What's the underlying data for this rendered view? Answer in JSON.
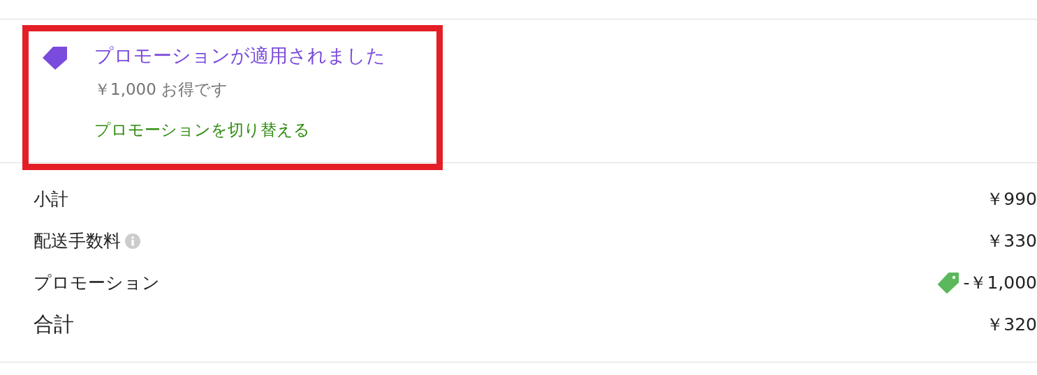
{
  "promotion": {
    "title": "プロモーションが適用されました",
    "savings": "￥1,000 お得です",
    "change_link": "プロモーションを切り替える",
    "highlighted": true
  },
  "summary": [
    {
      "kind": "plain",
      "label": "小計",
      "amount": "￥990"
    },
    {
      "kind": "info",
      "label": "配送手数料",
      "amount": "￥330"
    },
    {
      "kind": "promo",
      "label": "プロモーション",
      "amount": "-￥1,000"
    },
    {
      "kind": "total",
      "label": "合計",
      "amount": "￥320"
    }
  ]
}
